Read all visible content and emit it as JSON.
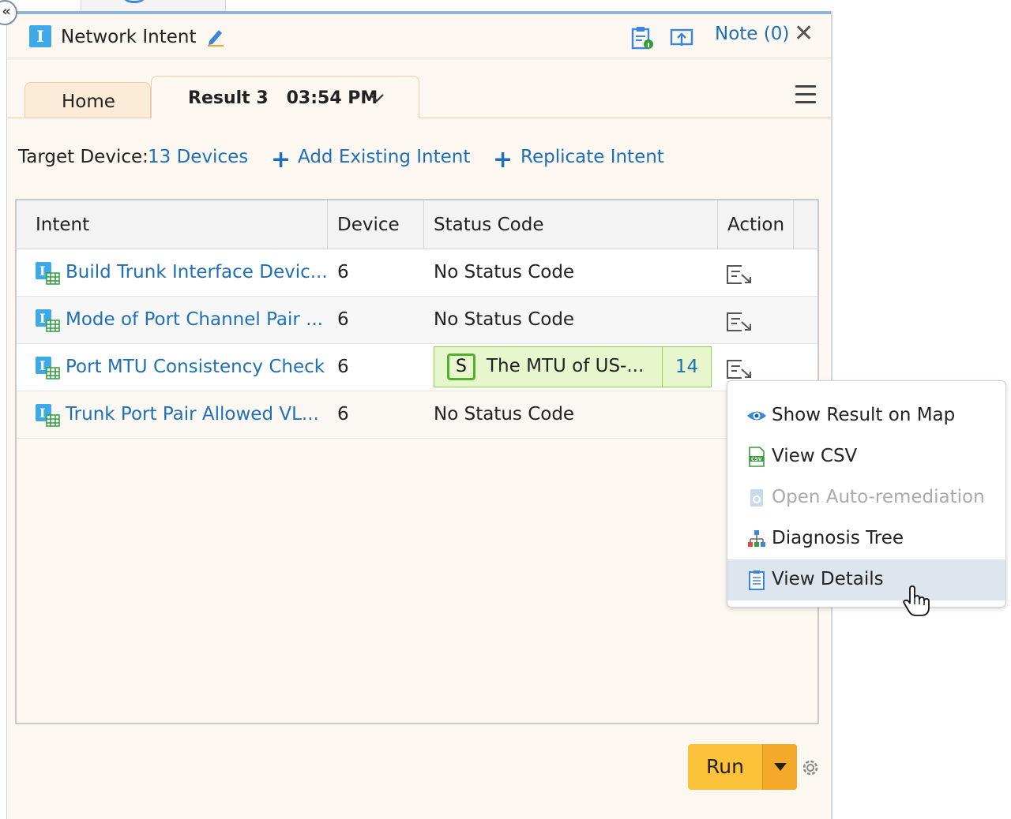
{
  "window": {
    "title": "Network Intent",
    "note_label": "Note (0)"
  },
  "tabs": [
    {
      "label": "Home"
    },
    {
      "label": "Result 3   03:54 PM"
    }
  ],
  "toolbar": {
    "target_label": "Target Device:",
    "target_value": "13 Devices",
    "add_existing": "Add Existing Intent",
    "replicate": "Replicate Intent"
  },
  "table": {
    "columns": [
      "Intent",
      "Device",
      "Status Code",
      "Action"
    ],
    "rows": [
      {
        "intent": "Build Trunk Interface Devic...",
        "device": "6",
        "status": "No Status Code"
      },
      {
        "intent": "Mode of Port Channel Pair ...",
        "device": "6",
        "status": "No Status Code"
      },
      {
        "intent": "Port MTU Consistency Check",
        "device": "6",
        "status_badge": "S",
        "status_text": "The MTU of US-...",
        "status_count": "14"
      },
      {
        "intent": "Trunk Port Pair Allowed VL...",
        "device": "6",
        "status": "No Status Code"
      }
    ]
  },
  "context_menu": {
    "items": [
      {
        "label": "Show Result on Map",
        "icon": "eye-icon"
      },
      {
        "label": "View CSV",
        "icon": "csv-file-icon"
      },
      {
        "label": "Open Auto-remediation",
        "icon": "auto-remediation-icon",
        "disabled": true
      },
      {
        "label": "Diagnosis Tree",
        "icon": "tree-icon"
      },
      {
        "label": "View Details",
        "icon": "clipboard-icon",
        "highlighted": true
      }
    ]
  },
  "footer": {
    "run_label": "Run"
  },
  "colors": {
    "link": "#1f6fb5",
    "panel_bg": "#fcf7f1",
    "run_button": "#fbc23a",
    "status_success": "#52b02c"
  }
}
